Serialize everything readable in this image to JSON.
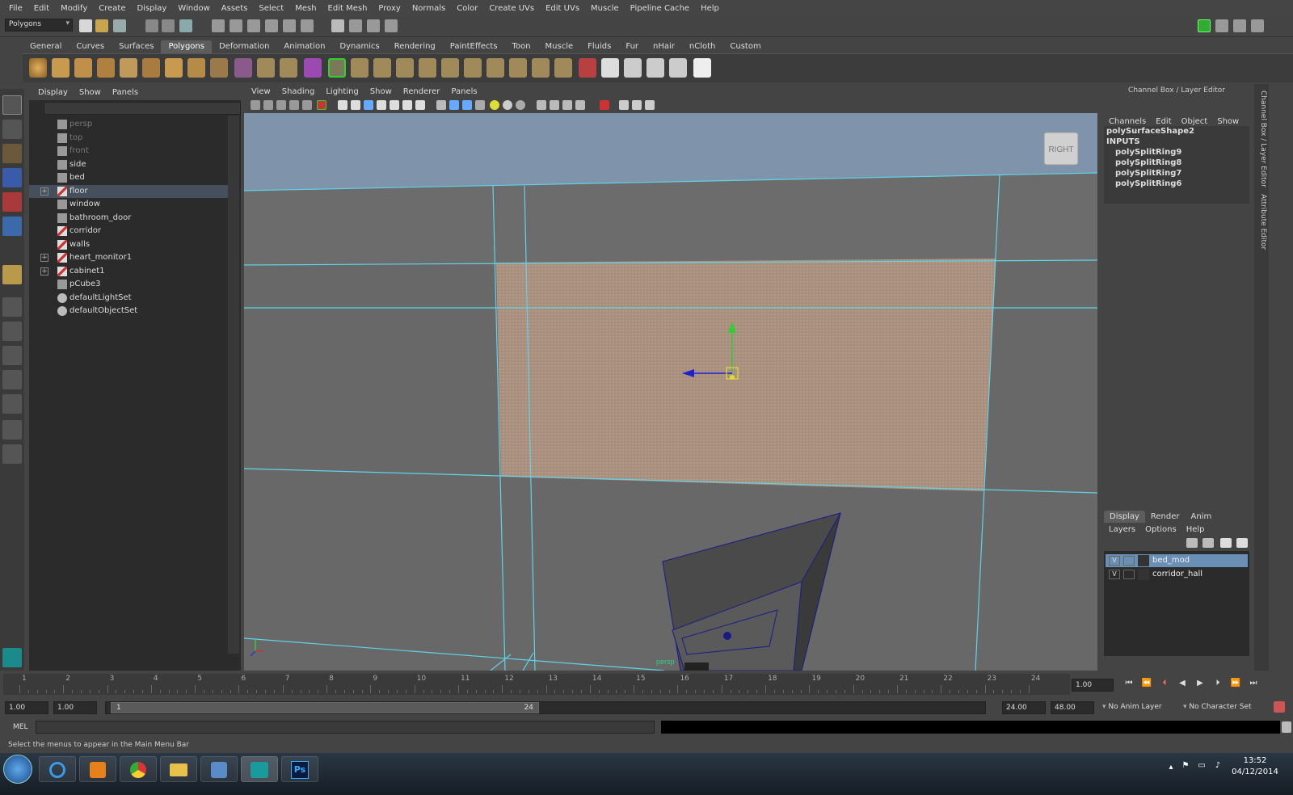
{
  "menubar": [
    "File",
    "Edit",
    "Modify",
    "Create",
    "Display",
    "Window",
    "Assets",
    "Select",
    "Mesh",
    "Edit Mesh",
    "Proxy",
    "Normals",
    "Color",
    "Create UVs",
    "Edit UVs",
    "Muscle",
    "Pipeline Cache",
    "Help"
  ],
  "status_line": {
    "mode": "Polygons"
  },
  "shelf_tabs": [
    "General",
    "Curves",
    "Surfaces",
    "Polygons",
    "Deformation",
    "Animation",
    "Dynamics",
    "Rendering",
    "PaintEffects",
    "Toon",
    "Muscle",
    "Fluids",
    "Fur",
    "nHair",
    "nCloth",
    "Custom"
  ],
  "shelf_active": "Polygons",
  "outliner": {
    "menu": [
      "Display",
      "Show",
      "Panels"
    ],
    "items": [
      {
        "label": "persp",
        "dim": true,
        "expand": false
      },
      {
        "label": "top",
        "dim": true,
        "expand": false
      },
      {
        "label": "front",
        "dim": true,
        "expand": false
      },
      {
        "label": "side",
        "dim": false,
        "expand": false
      },
      {
        "label": "bed",
        "dim": false,
        "expand": false
      },
      {
        "label": "floor",
        "dim": false,
        "expand": true,
        "selected": true
      },
      {
        "label": "window",
        "dim": false,
        "expand": false
      },
      {
        "label": "bathroom_door",
        "dim": false,
        "expand": false
      },
      {
        "label": "corridor",
        "dim": false,
        "expand": false
      },
      {
        "label": "walls",
        "dim": false,
        "expand": false
      },
      {
        "label": "heart_monitor1",
        "dim": false,
        "expand": true
      },
      {
        "label": "cabinet1",
        "dim": false,
        "expand": true
      },
      {
        "label": "pCube3",
        "dim": false,
        "expand": false
      },
      {
        "label": "defaultLightSet",
        "dim": false,
        "expand": false
      },
      {
        "label": "defaultObjectSet",
        "dim": false,
        "expand": false
      }
    ]
  },
  "panel": {
    "menu": [
      "View",
      "Shading",
      "Lighting",
      "Show",
      "Renderer",
      "Panels"
    ],
    "view_cube_label": "RIGHT",
    "camera_label": "persp"
  },
  "channel_box": {
    "title": "Channel Box / Layer Editor",
    "menu": [
      "Channels",
      "Edit",
      "Object",
      "Show"
    ],
    "shape": "polySurfaceShape2",
    "inputs_label": "INPUTS",
    "inputs": [
      "polySplitRing9",
      "polySplitRing8",
      "polySplitRing7",
      "polySplitRing6"
    ]
  },
  "layer_editor": {
    "tabs": [
      "Display",
      "Render",
      "Anim"
    ],
    "active_tab": "Display",
    "menu": [
      "Layers",
      "Options",
      "Help"
    ],
    "layers": [
      {
        "name": "bed_mod",
        "visible": "V",
        "selected": true
      },
      {
        "name": "corridor_hall",
        "visible": "V",
        "selected": false
      }
    ]
  },
  "side_tabs": [
    "Channel Box / Layer Editor",
    "Attribute Editor"
  ],
  "time_slider": {
    "ticks": [
      "1",
      "2",
      "3",
      "4",
      "5",
      "6",
      "7",
      "8",
      "9",
      "10",
      "11",
      "12",
      "13",
      "14",
      "15",
      "16",
      "17",
      "18",
      "19",
      "20",
      "21",
      "22",
      "23",
      "24"
    ],
    "current_time": "1.00"
  },
  "range_slider": {
    "start_time": "1.00",
    "playback_start": "1.00",
    "range_start": "1",
    "range_end": "24",
    "playback_end": "24.00",
    "end_time": "48.00",
    "anim_layer": "No Anim Layer",
    "character_set": "No Character Set"
  },
  "command_line": {
    "label": "MEL"
  },
  "help_line": "Select the menus to appear in the Main Menu Bar",
  "taskbar": {
    "time": "13:52",
    "date": "04/12/2014",
    "photoshop_label": "Ps"
  },
  "colors": {
    "selection_blue": "#6a8fb5",
    "viewport_sky": "#7f93ab",
    "wireframe_cyan": "#5fd3e8",
    "floor_tan": "#a88e7c"
  }
}
